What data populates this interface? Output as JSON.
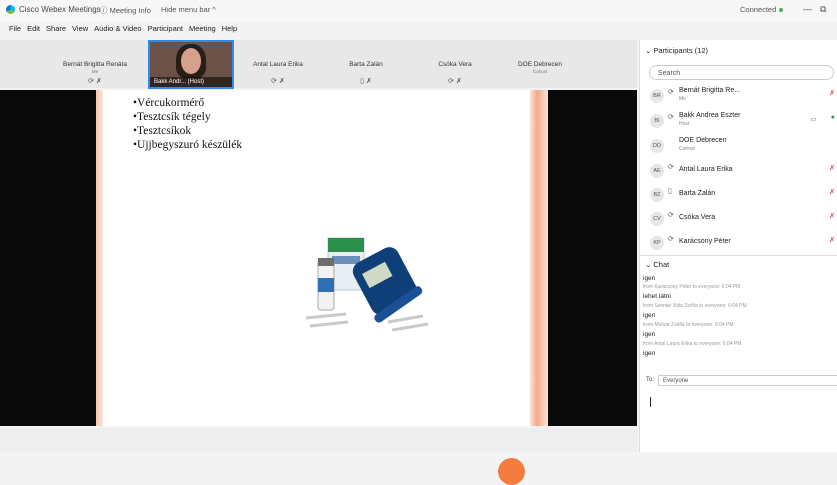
{
  "titlebar": {
    "app_name": "Cisco Webex Meetings",
    "meeting_info": "Meeting Info",
    "hide_menu": "Hide menu bar ^",
    "status": "Connected",
    "minimize": "—",
    "restore": "⧉"
  },
  "menu": [
    "File",
    "Edit",
    "Share",
    "View",
    "Audio & Video",
    "Participant",
    "Meeting",
    "Help"
  ],
  "video_strip": {
    "tiles": [
      {
        "name": "Bernát Brigitta Renáta",
        "sub": "Me",
        "icons": "⟳ ✗"
      },
      {
        "name": "Antal Laura Erika",
        "sub": "",
        "icons": "⟳ ✗"
      },
      {
        "name": "Barta Zalán",
        "sub": "",
        "icons": "▯ ✗"
      },
      {
        "name": "Csóka Vera",
        "sub": "",
        "icons": "⟳ ✗"
      },
      {
        "name": "DOE Debrecen",
        "sub": "Cohost",
        "icons": ""
      }
    ],
    "active_label": "Bakk Andr... (Host)"
  },
  "slide": {
    "bullets": [
      "•Vércukormérő",
      "•Tesztcsík tégely",
      "•Tesztcsíkok",
      "•Ujjbegyszuró készülék"
    ]
  },
  "participants": {
    "title": "Participants (12)",
    "search_placeholder": "Search",
    "list": [
      {
        "initials": "BR",
        "name": "Bernát Brigitta Re...",
        "role": "Me"
      },
      {
        "initials": "BI",
        "name": "Bakk Andrea Eszter",
        "role": "Host"
      },
      {
        "initials": "DD",
        "name": "DOE Debrecen",
        "role": "Cohost"
      },
      {
        "initials": "AE",
        "name": "Antal Laura Erika",
        "role": ""
      },
      {
        "initials": "BZ",
        "name": "Barta Zalán",
        "role": ""
      },
      {
        "initials": "CV",
        "name": "Csóka Vera",
        "role": ""
      },
      {
        "initials": "KP",
        "name": "Karácsony Péter",
        "role": ""
      }
    ]
  },
  "chat": {
    "title": "Chat",
    "messages": [
      {
        "text": "igen",
        "meta": "from Karácsony Péter to everyone:   6:04 PM"
      },
      {
        "text": "lehet látni",
        "meta": "from Szentei Júlia Zsófia to everyone:   6:04 PM"
      },
      {
        "text": "igen",
        "meta": "from Molnár Zsófia to everyone:   6:04 PM"
      },
      {
        "text": "igen",
        "meta": "from Antal Laura Erika to everyone:   6:04 PM"
      },
      {
        "text": "igen",
        "meta": ""
      }
    ],
    "to_label": "To:",
    "to_value": "Everyone"
  },
  "colors": {
    "accent": "#2e8cf0",
    "muted": "#e04040",
    "orange": "#f47c3c"
  }
}
